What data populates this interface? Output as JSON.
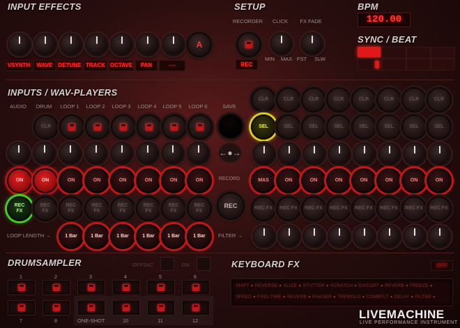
{
  "input_effects": {
    "title": "INPUT EFFECTS",
    "tags": [
      "VSYNTH",
      "WAVE",
      "DETUNE",
      "TRACK",
      "OCTAVE",
      "PAN",
      "----"
    ],
    "a_button": "A"
  },
  "setup": {
    "title": "SETUP",
    "recorder_label": "RECORDER",
    "click_label": "CLICK",
    "fx_fade_label": "FX FADE",
    "click_min": "MIN",
    "click_max": "MAX",
    "fade_fst": "FST",
    "fade_slw": "SLW",
    "rec_label": "REC"
  },
  "bpm": {
    "title": "BPM",
    "value": "120.00"
  },
  "sync": {
    "title": "SYNC / BEAT"
  },
  "inputs": {
    "title": "INPUTS / WAV-PLAYERS",
    "columns": [
      "AUDIO",
      "DRUM",
      "LOOP 1",
      "LOOP 2",
      "LOOP 3",
      "LOOP 4",
      "LOOP 5",
      "LOOP 6"
    ],
    "save_label": "SAVE",
    "clr": "CLR",
    "on": "ON",
    "rec_fx": "REC\nFX",
    "record_label": "RECORD",
    "rec_big": "REC",
    "loop_length_label": "LOOP LENGTH",
    "bar": "1 Bar",
    "filter_label": "FILTER"
  },
  "grid": {
    "clr": "CLR",
    "sel": "SEL",
    "mas": "MAS",
    "on": "ON",
    "rec_fx": "REC FX"
  },
  "drumsampler": {
    "title": "DRUMSAMPLER",
    "opt1": "OFFSAC",
    "opt2": "ON",
    "numbers_top": [
      "1",
      "2",
      "3",
      "4",
      "5",
      "6"
    ],
    "numbers_bottom": [
      "7",
      "8",
      "ONE-SHOT",
      "10",
      "11",
      "12"
    ]
  },
  "keyboard_fx": {
    "title": "KEYBOARD FX",
    "off": "OFF",
    "row1": "SHIFT ● REVERSE ● SLICE ● STUTTER ● SCRATCH ● DISTORT ● REVERB ● FREEZE ●",
    "row2": "SPEED ● FIND-TIME ● REVERB ● PHASER ● TREMOLO ● COMBFLT ● DELAY ● FILTER ●"
  },
  "brand": {
    "name": "LIVEMACHINE",
    "tagline": "LIVE PERFORMANCE INSTRUMENT"
  },
  "colors": {
    "accent": "#ff2a2a",
    "highlight_sel": "#e0e020",
    "highlight_recfx": "#40d020"
  }
}
